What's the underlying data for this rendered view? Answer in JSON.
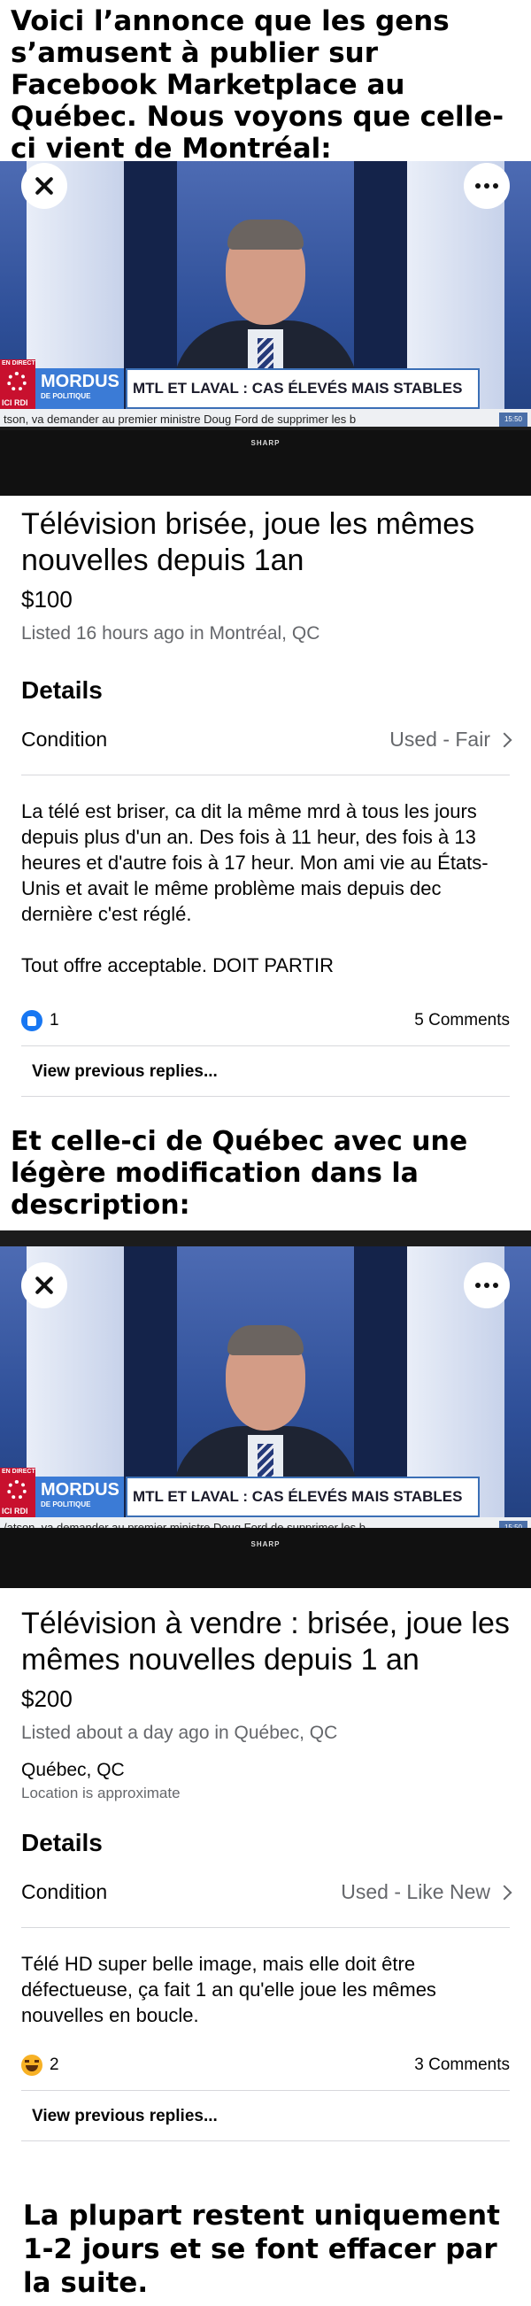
{
  "captions": {
    "intro": "Voici l’annonce que les gens s’amusent à publier sur Facebook Marketplace au Québec. Nous voyons que celle-ci vient de Montréal:",
    "second": "Et celle-ci de Québec avec une légère modification dans la description:",
    "outro": "La plupart restent uniquement 1-2 jours et se font effacer par la suite."
  },
  "tv": {
    "direct_tag": "EN DIRECT",
    "rci": "ICI RDI",
    "show_name": "MORDUS",
    "show_sub": "DE POLITIQUE",
    "headline": "MTL ET LAVAL : CAS ÉLEVÉS MAIS STABLES",
    "ticker_1": "tson, va demander au premier ministre Doug Ford de supprimer les b",
    "ticker_2": "/atson, va demander au premier ministre Doug Ford de supprimer les b",
    "time": "15:50",
    "brand": "SHARP"
  },
  "listings": [
    {
      "title": "Télévision brisée, joue les mêmes nouvelles depuis 1an",
      "price": "$100",
      "meta": "Listed 16 hours ago in Montréal, QC",
      "details_heading": "Details",
      "condition_label": "Condition",
      "condition_value": "Used - Fair",
      "description_1": "La télé est briser, ca dit la même mrd à tous les jours depuis plus d'un an. Des fois à 11 heur, des fois à 13 heures et d'autre fois à 17 heur. Mon ami vie au États-Unis et avait le même problème mais depuis dec dernière c'est réglé.",
      "description_2": "Tout offre acceptable. DOIT PARTIR",
      "reaction_count": "1",
      "comments": "5 Comments",
      "view_previous": "View previous replies..."
    },
    {
      "title": "Télévision à vendre : brisée, joue les mêmes nouvelles depuis 1 an",
      "price": "$200",
      "meta": "Listed about a day ago in Québec, QC",
      "location_name": "Québec, QC",
      "location_note": "Location is approximate",
      "details_heading": "Details",
      "condition_label": "Condition",
      "condition_value": "Used - Like New",
      "description_1": "Télé HD super belle image, mais elle doit être défectueuse, ça fait 1 an qu'elle joue les mêmes nouvelles en boucle.",
      "reaction_count": "2",
      "comments": "3 Comments",
      "view_previous": "View previous replies..."
    }
  ],
  "colors": {
    "like_blue": "#1877f2",
    "haha_yellow": "#f7b125",
    "secondary_text": "#65676b",
    "rci_red": "#c8102e",
    "mordus_blue": "#3b7bd6"
  },
  "icons": [
    "close-icon",
    "more-options-icon",
    "chevron-right-icon",
    "like-reaction-icon",
    "haha-reaction-icon",
    "ici-rdi-logo"
  ]
}
